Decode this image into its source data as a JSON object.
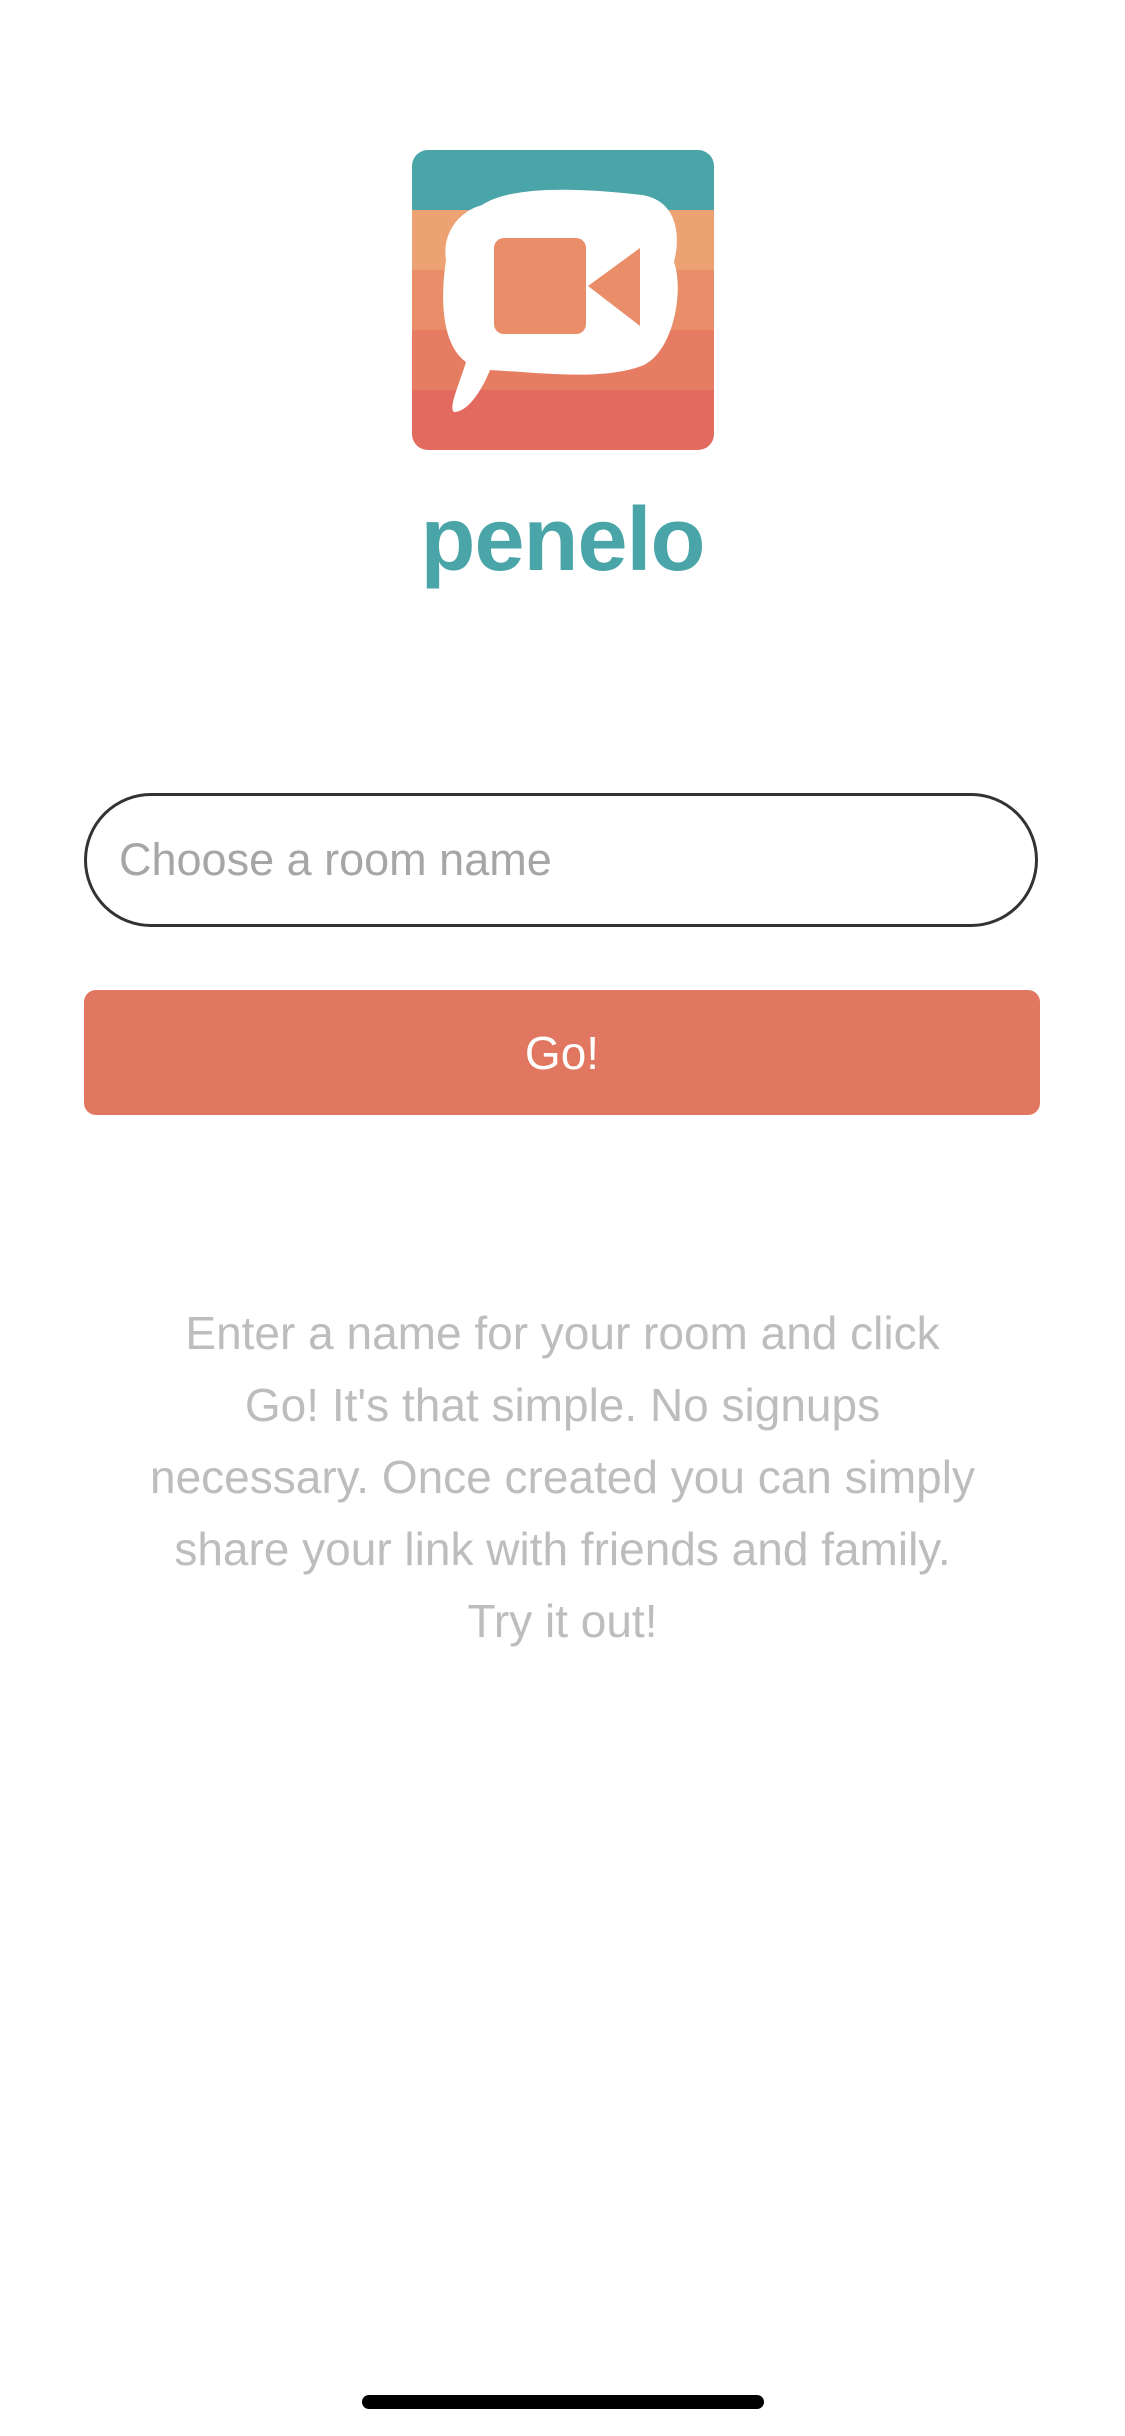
{
  "app": {
    "brand_name": "penelo",
    "logo_icon": "video-chat-bubble-icon"
  },
  "form": {
    "room_input_value": "",
    "room_input_placeholder": "Choose a room name",
    "go_label": "Go!"
  },
  "description": "Enter a name for your room and click Go! It's that simple. No signups necessary. Once created you can simply share your link with friends and family. Try it out!",
  "colors": {
    "brand_teal": "#4aa5a8",
    "button_coral": "#e27761",
    "input_border": "#333333",
    "placeholder_gray": "#a6a6a6",
    "description_gray": "#bdbdbd",
    "logo_stripes": [
      "#4aa5a8",
      "#eca273",
      "#e98e69",
      "#e67c62",
      "#e36a5e"
    ]
  }
}
